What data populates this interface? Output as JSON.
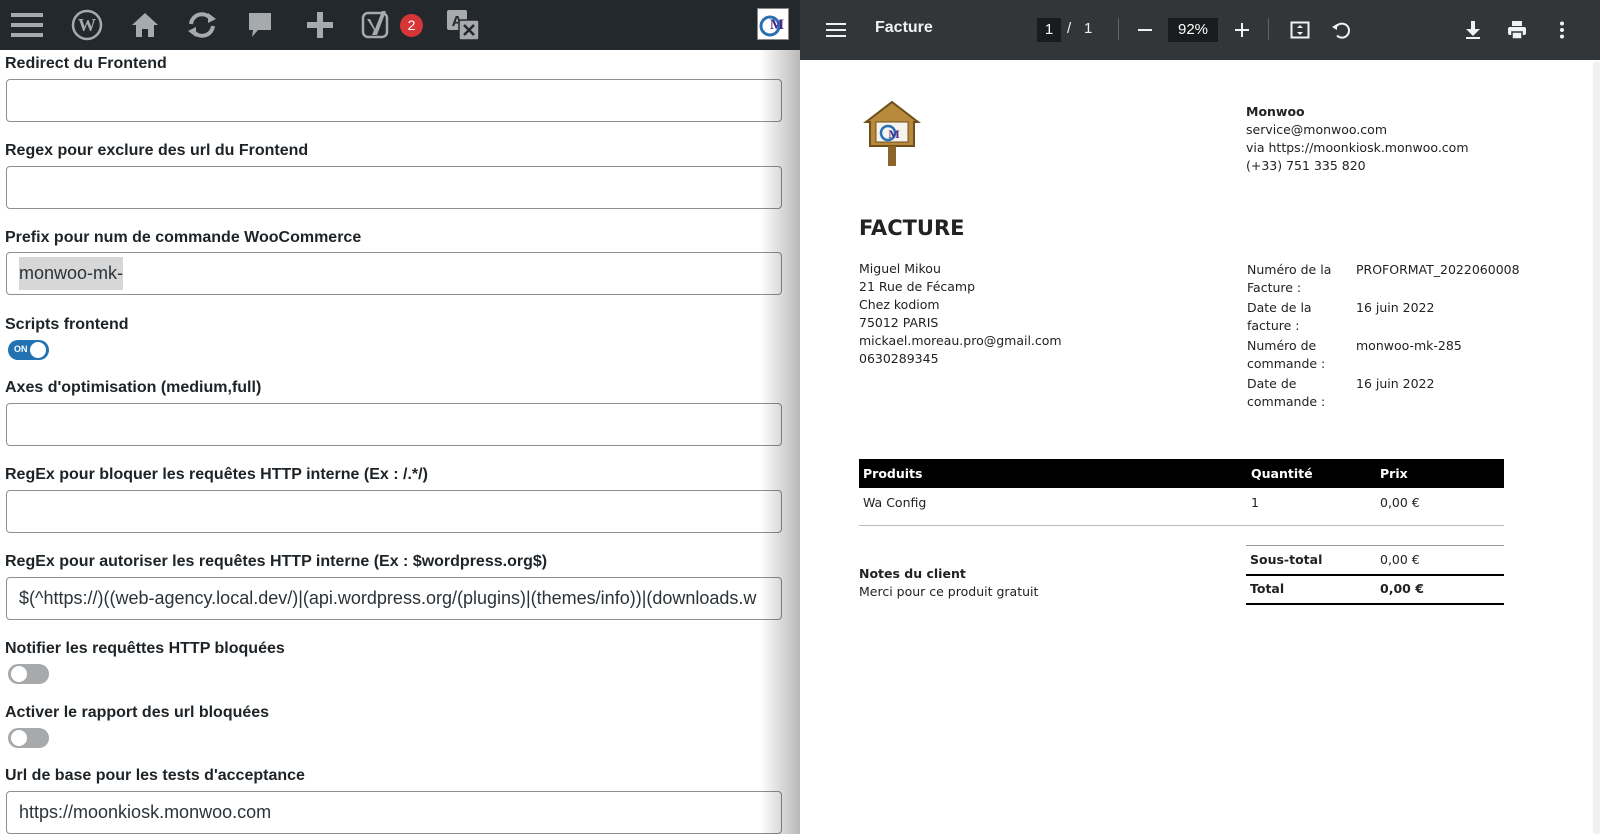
{
  "wp_admin_bar": {
    "notification_count": "2",
    "icons": [
      "menu-icon",
      "wordpress-logo-icon",
      "home-icon",
      "refresh-icon",
      "comment-icon",
      "plus-icon",
      "yoast-icon",
      "translate-icon",
      "avatar"
    ]
  },
  "settings": {
    "fields": [
      {
        "label": "Redirect du Frontend",
        "value": ""
      },
      {
        "label": "Regex pour exclure des url du Frontend",
        "value": ""
      },
      {
        "label": "Prefix pour num de commande WooCommerce",
        "value": "monwoo-mk-"
      },
      {
        "label": "Axes d'optimisation (medium,full)",
        "value": ""
      },
      {
        "label": "RegEx pour bloquer les requêtes HTTP interne (Ex : /.*/)",
        "value": ""
      },
      {
        "label": "RegEx pour autoriser les requêtes HTTP interne (Ex : $wordpress.org$)",
        "value": "$(^https://)((web-agency.local.dev/)|(api.wordpress.org/(plugins)|(themes/info))|(downloads.w"
      },
      {
        "label": "Url de base pour les tests d'acceptance",
        "value": "https://moonkiosk.monwoo.com"
      }
    ],
    "toggles": [
      {
        "label": "Scripts frontend",
        "state": "ON",
        "on": true
      },
      {
        "label": "Notifier les requêttes HTTP bloquées",
        "on": false
      },
      {
        "label": "Activer le rapport des url bloquées",
        "on": false
      }
    ]
  },
  "pdf_viewer": {
    "title": "Facture",
    "current_page": "1",
    "separator": "/",
    "total_pages": "1",
    "zoom": "92%"
  },
  "invoice": {
    "company": {
      "name": "Monwoo",
      "email": "service@monwoo.com",
      "via": "via https://moonkiosk.monwoo.com",
      "phone": "(+33) 751 335 820"
    },
    "heading": "FACTURE",
    "customer": {
      "name": "Miguel Mikou",
      "street": "21 Rue de Fécamp",
      "extra": "Chez kodiom",
      "city": "75012 PARIS",
      "email": "mickael.moreau.pro@gmail.com",
      "phone": "0630289345"
    },
    "meta": {
      "invoice_number_label_1": "Numéro de la",
      "invoice_number_label_2": "Facture :",
      "invoice_number": "PROFORMAT_2022060008",
      "invoice_date_label_1": "Date de la",
      "invoice_date_label_2": "facture :",
      "invoice_date": "16 juin 2022",
      "order_number_label_1": "Numéro de",
      "order_number_label_2": "commande :",
      "order_number": "monwoo-mk-285",
      "order_date_label_1": "Date de",
      "order_date_label_2": "commande :",
      "order_date": "16 juin 2022"
    },
    "table": {
      "headers": [
        "Produits",
        "Quantité",
        "Prix"
      ],
      "rows": [
        {
          "product": "Wa Config",
          "quantity": "1",
          "price": "0,00 €"
        }
      ]
    },
    "notes_title": "Notes du client",
    "notes": "Merci pour ce produit gratuit",
    "totals": {
      "subtotal_label": "Sous-total",
      "subtotal": "0,00 €",
      "total_label": "Total",
      "total": "0,00 €"
    }
  }
}
